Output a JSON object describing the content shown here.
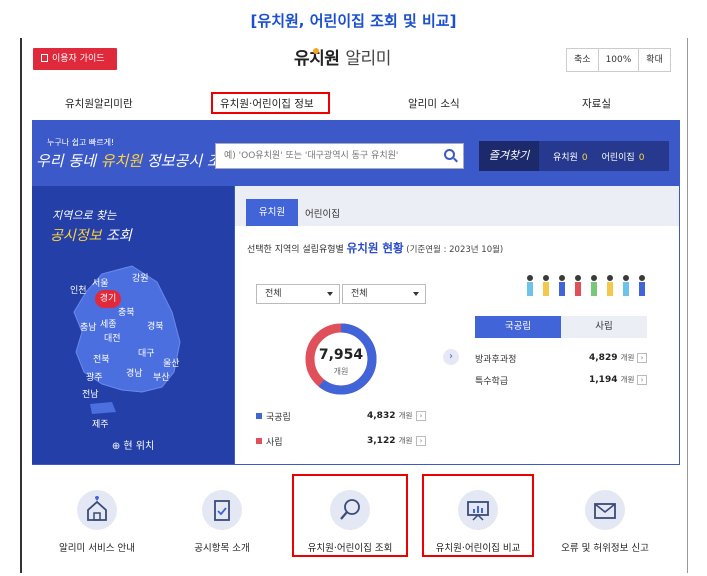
{
  "caption": "[유치원, 어린이집 조회 및 비교]",
  "header": {
    "guide_button": "이용자 가이드",
    "logo_main": "유치원",
    "logo_sub": "알리미",
    "zoom": {
      "shrink": "축소",
      "level": "100%",
      "enlarge": "확대"
    }
  },
  "nav": [
    "유치원알리미란",
    "유치원·어린이집 정보",
    "알리미 소식",
    "자료실"
  ],
  "banner": {
    "tagline_small": "누구나 쉽고 빠르게!",
    "tagline_a": "우리 동네 ",
    "tagline_b": "유치원",
    "tagline_c": " 정보공시 조회",
    "search_placeholder": "예) 'OO유치원' 또는 '대구광역시 동구 유치원'",
    "fav_label": "즐겨찾기",
    "fav_kindergarten": "유치원",
    "fav_kindergarten_count": "0",
    "fav_daycare": "어린이집",
    "fav_daycare_count": "0"
  },
  "map": {
    "title_line1": "지역으로 찾는",
    "title_line2a": "공시정보",
    "title_line2b": " 조회",
    "regions": [
      "인천",
      "서울",
      "강원",
      "경기",
      "충북",
      "세종",
      "충남",
      "대전",
      "경북",
      "전북",
      "대구",
      "울산",
      "광주",
      "경남",
      "부산",
      "전남",
      "제주"
    ],
    "current_location": "현 위치"
  },
  "panel": {
    "tabs": [
      "유치원",
      "어린이집"
    ],
    "status_prefix": "선택한 지역의 설립유형별 ",
    "status_highlight": "유치원 현황",
    "status_suffix": " (기준연월 : 2023년 10월)",
    "select_region": "전체",
    "select_type": "전체",
    "total": "7,954",
    "total_unit": "개원",
    "type_tabs": [
      "국공립",
      "사립"
    ],
    "accent_public": "#4164d8",
    "accent_private": "#e0505a"
  },
  "chart_data": {
    "type": "pie",
    "categories": [
      "국공립",
      "사립"
    ],
    "values": [
      4832,
      3122
    ],
    "total": 7954,
    "unit": "개원"
  },
  "legend": [
    {
      "label": "국공립",
      "value": "4,832",
      "unit": "개원"
    },
    {
      "label": "사립",
      "value": "3,122",
      "unit": "개원"
    }
  ],
  "stats": [
    {
      "label": "방과후과정",
      "value": "4,829",
      "unit": "개원"
    },
    {
      "label": "특수학급",
      "value": "1,194",
      "unit": "개원"
    }
  ],
  "bottom_menu": [
    {
      "label": "알리미 서비스 안내",
      "icon": "house-heart-icon"
    },
    {
      "label": "공시항목 소개",
      "icon": "clipboard-check-icon"
    },
    {
      "label": "유치원·어린이집 조회",
      "icon": "magnifier-icon"
    },
    {
      "label": "유치원·어린이집 비교",
      "icon": "presentation-board-icon"
    },
    {
      "label": "오류 및 허위정보 신고",
      "icon": "envelope-icon"
    }
  ]
}
